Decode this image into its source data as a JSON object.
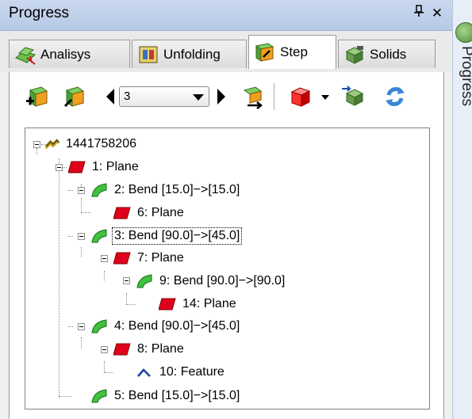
{
  "panel": {
    "title": "Progress",
    "pin_icon": "pin-icon",
    "close_label": "✕",
    "side_tab_label": "Progress"
  },
  "tabs": [
    {
      "label": "Analisys",
      "icon": "analysis-icon",
      "active": false
    },
    {
      "label": "Unfolding",
      "icon": "unfolding-icon",
      "active": false
    },
    {
      "label": "Step",
      "icon": "step-icon",
      "active": true
    },
    {
      "label": "Solids",
      "icon": "solids-icon",
      "active": false
    }
  ],
  "toolbar": {
    "step_select_value": "3",
    "icons": [
      "add-step-icon",
      "edit-step-icon",
      "previous-icon",
      "next-icon",
      "apply-steps-icon",
      "solid-view-icon",
      "export-icon",
      "refresh-icon"
    ]
  },
  "tree": {
    "root": "1441758206",
    "nodes": [
      {
        "label": "1: Plane",
        "type": "plane"
      },
      {
        "label": "2: Bend [15.0]−>[15.0]",
        "type": "bend"
      },
      {
        "label": "6: Plane",
        "type": "plane"
      },
      {
        "label": "3: Bend [90.0]−>[45.0]",
        "type": "bend",
        "selected": true
      },
      {
        "label": "7: Plane",
        "type": "plane"
      },
      {
        "label": "9: Bend [90.0]−>[90.0]",
        "type": "bend"
      },
      {
        "label": "14: Plane",
        "type": "plane"
      },
      {
        "label": "4: Bend [90.0]−>[45.0]",
        "type": "bend"
      },
      {
        "label": "8: Plane",
        "type": "plane"
      },
      {
        "label": "10: Feature",
        "type": "feature"
      },
      {
        "label": "5: Bend [15.0]−>[15.0]",
        "type": "bend"
      }
    ]
  },
  "colors": {
    "plane": "#e0001b",
    "bend": "#3fc23f",
    "feature": "#1c3f9e",
    "title_bar": "#c0d2ec"
  }
}
